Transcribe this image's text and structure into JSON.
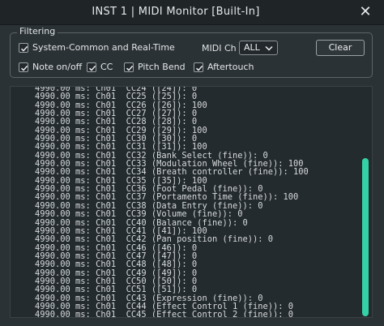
{
  "window": {
    "title": "INST 1 | MIDI Monitor [Built-In]",
    "close_symbol": "✕"
  },
  "filtering": {
    "legend": "Filtering",
    "system_common": {
      "label": "System-Common and Real-Time",
      "checked": true
    },
    "midi_ch_label": "MIDI Ch",
    "midi_ch_value": "ALL",
    "clear_label": "Clear",
    "note_onoff": {
      "label": "Note on/off",
      "checked": true
    },
    "cc": {
      "label": "CC",
      "checked": true
    },
    "pitch_bend": {
      "label": "Pitch Bend",
      "checked": true
    },
    "aftertouch": {
      "label": "Aftertouch",
      "checked": true
    }
  },
  "log_lines": [
    "4990.00 ms: Ch01  CC24 ([24]): 0",
    "4990.00 ms: Ch01  CC25 ([25]): 0",
    "4990.00 ms: Ch01  CC26 ([26]): 100",
    "4990.00 ms: Ch01  CC27 ([27]): 0",
    "4990.00 ms: Ch01  CC28 ([28]): 0",
    "4990.00 ms: Ch01  CC29 ([29]): 100",
    "4990.00 ms: Ch01  CC30 ([30]): 0",
    "4990.00 ms: Ch01  CC31 ([31]): 100",
    "4990.00 ms: Ch01  CC32 (Bank Select (fine)): 0",
    "4990.00 ms: Ch01  CC33 (Modulation Wheel (fine)): 100",
    "4990.00 ms: Ch01  CC34 (Breath controller (fine)): 100",
    "4990.00 ms: Ch01  CC35 ([35]): 100",
    "4990.00 ms: Ch01  CC36 (Foot Pedal (fine)): 0",
    "4990.00 ms: Ch01  CC37 (Portamento Time (fine)): 100",
    "4990.00 ms: Ch01  CC38 (Data Entry (fine)): 0",
    "4990.00 ms: Ch01  CC39 (Volume (fine)): 0",
    "4990.00 ms: Ch01  CC40 (Balance (fine)): 0",
    "4990.00 ms: Ch01  CC41 ([41]): 100",
    "4990.00 ms: Ch01  CC42 (Pan position (fine)): 0",
    "4990.00 ms: Ch01  CC46 ([46]): 0",
    "4990.00 ms: Ch01  CC47 ([47]): 0",
    "4990.00 ms: Ch01  CC48 ([48]): 0",
    "4990.00 ms: Ch01  CC49 ([49]): 0",
    "4990.00 ms: Ch01  CC50 ([50]): 0",
    "4990.00 ms: Ch01  CC51 ([51]): 0",
    "4990.00 ms: Ch01  CC43 (Expression (fine)): 0",
    "4990.00 ms: Ch01  CC44 (Effect Control 1 (fine)): 0",
    "4990.00 ms: Ch01  CC45 (Effect Control 2 (fine)): 0"
  ],
  "colors": {
    "accent": "#34d1a6",
    "background": "#2b3236",
    "log_background": "#242b2f"
  }
}
